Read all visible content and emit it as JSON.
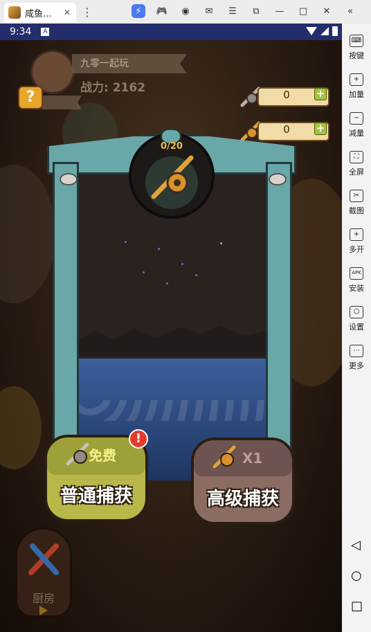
{
  "emulator": {
    "tab_title": "咸鱼...",
    "close_glyph": "✕",
    "kebab_glyph": "⋮",
    "top_icons": [
      {
        "name": "lightning-icon",
        "glyph": "⚡"
      },
      {
        "name": "gamepad-icon",
        "glyph": "🎮"
      },
      {
        "name": "account-icon",
        "glyph": "◉"
      },
      {
        "name": "mail-icon",
        "glyph": "✉"
      },
      {
        "name": "menu-icon",
        "glyph": "☰"
      },
      {
        "name": "window-restore-icon",
        "glyph": "⧉"
      },
      {
        "name": "minimize-icon",
        "glyph": "—"
      },
      {
        "name": "maximize-icon",
        "glyph": "□"
      },
      {
        "name": "close-icon",
        "glyph": "✕"
      },
      {
        "name": "collapse-icon",
        "glyph": "«"
      }
    ],
    "sidebar": [
      {
        "label": "按键",
        "name": "keymap",
        "glyph": "⌨"
      },
      {
        "label": "加量",
        "name": "volume-up",
        "glyph": "+"
      },
      {
        "label": "减量",
        "name": "volume-down",
        "glyph": "−"
      },
      {
        "label": "全屏",
        "name": "fullscreen",
        "glyph": "⛶"
      },
      {
        "label": "截图",
        "name": "screenshot",
        "glyph": "✂"
      },
      {
        "label": "多开",
        "name": "multi-instance",
        "glyph": "+"
      },
      {
        "label": "安装",
        "name": "install-apk",
        "glyph": "APK"
      },
      {
        "label": "设置",
        "name": "settings",
        "glyph": "⬡"
      },
      {
        "label": "更多",
        "name": "more",
        "glyph": "⋯"
      }
    ],
    "nav": {
      "back": "◁",
      "home": "○",
      "recents": "□"
    }
  },
  "status_bar": {
    "time": "9:34",
    "badge": "A"
  },
  "game": {
    "player_name": "九零一起玩",
    "power_label": "战力: 2162",
    "help_glyph": "?",
    "resources": [
      {
        "name": "normal-rod",
        "value": "0",
        "plus": "+"
      },
      {
        "name": "golden-rod",
        "value": "0",
        "plus": "+"
      }
    ],
    "capture_count": "0/20",
    "normal_capture": {
      "sub": "免费",
      "label": "普通捕获",
      "notif": "!"
    },
    "advanced_capture": {
      "sub": "X1",
      "label": "高级捕获"
    },
    "kitchen_label": "厨房"
  },
  "colors": {
    "frame_teal": "#6aa7a8",
    "normal_btn": "#b8b84a",
    "advanced_btn": "#8a6c62",
    "water_blue": "#3c5f9d",
    "status_bar": "#242d6b"
  }
}
